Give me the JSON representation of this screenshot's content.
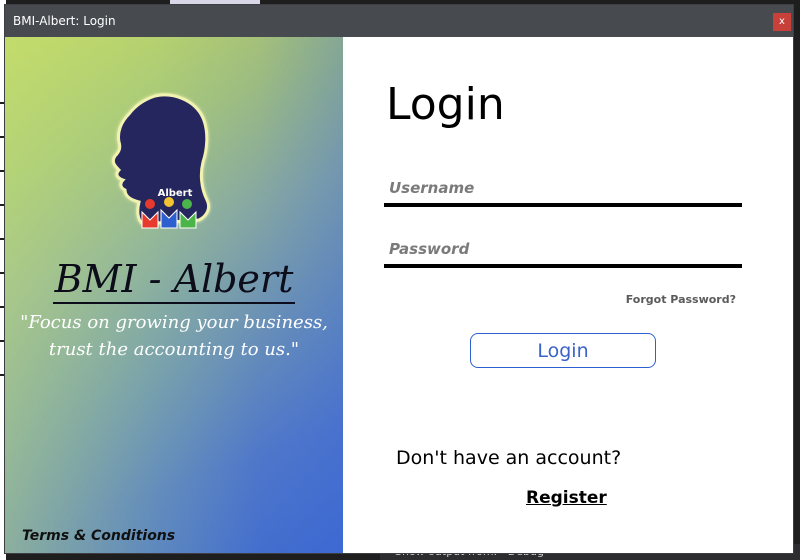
{
  "window": {
    "title": "BMI-Albert: Login",
    "close_label": "x"
  },
  "brand": {
    "logo_text": "Albert",
    "name": "BMI - Albert",
    "tagline": "\"Focus on growing your business,\ntrust the accounting to us.\"",
    "terms_label": "Terms & Conditions"
  },
  "form": {
    "title": "Login",
    "username_placeholder": "Username",
    "password_placeholder": "Password",
    "forgot_label": "Forgot Password?",
    "login_label": "Login",
    "no_account_text": "Don't have an account?",
    "register_label": "Register"
  },
  "background": {
    "status_text": "Show output from:   Debug"
  },
  "colors": {
    "titlebar": "#474b50",
    "close_button": "#c8403a",
    "login_border": "#2d5fd0",
    "login_text": "#3a62c8"
  }
}
